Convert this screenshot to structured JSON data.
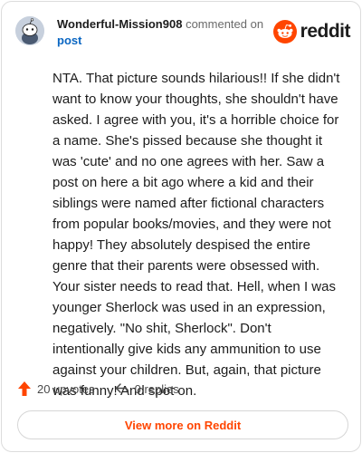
{
  "header": {
    "author": "Wonderful-Mission908",
    "action": "commented on",
    "post_link": "post",
    "logo_text": "reddit"
  },
  "comment": {
    "text": "NTA. That picture sounds hilarious!! If she didn't want to know your thoughts, she shouldn't have asked. I agree with you, it's a horrible choice for a name. She's pissed because she thought it was 'cute' and no one agrees with her. Saw a post on here a bit ago where a kid and their siblings were named after fictional characters from popular books/movies, and they were not happy! They absolutely despised the entire genre that their parents were obsessed with. Your sister needs to read that. Hell, when I was younger Sherlock was used in an expression, negatively. \"No shit, Sherlock\". Don't intentionally give kids any ammunition to use against your children. But, again, that picture was funny! And spot on."
  },
  "footer": {
    "upvotes": "20 upvotes",
    "replies": "0 replies"
  },
  "cta": {
    "label": "View more on Reddit"
  },
  "colors": {
    "accent": "#ff4500",
    "link": "#0a66c2",
    "avatar_bg": "#c7d0dd"
  },
  "icons": {
    "avatar": "snoo-avatar-icon",
    "logo": "reddit-logo-icon",
    "upvote": "upvote-arrow-icon",
    "reply": "reply-arrow-icon"
  }
}
